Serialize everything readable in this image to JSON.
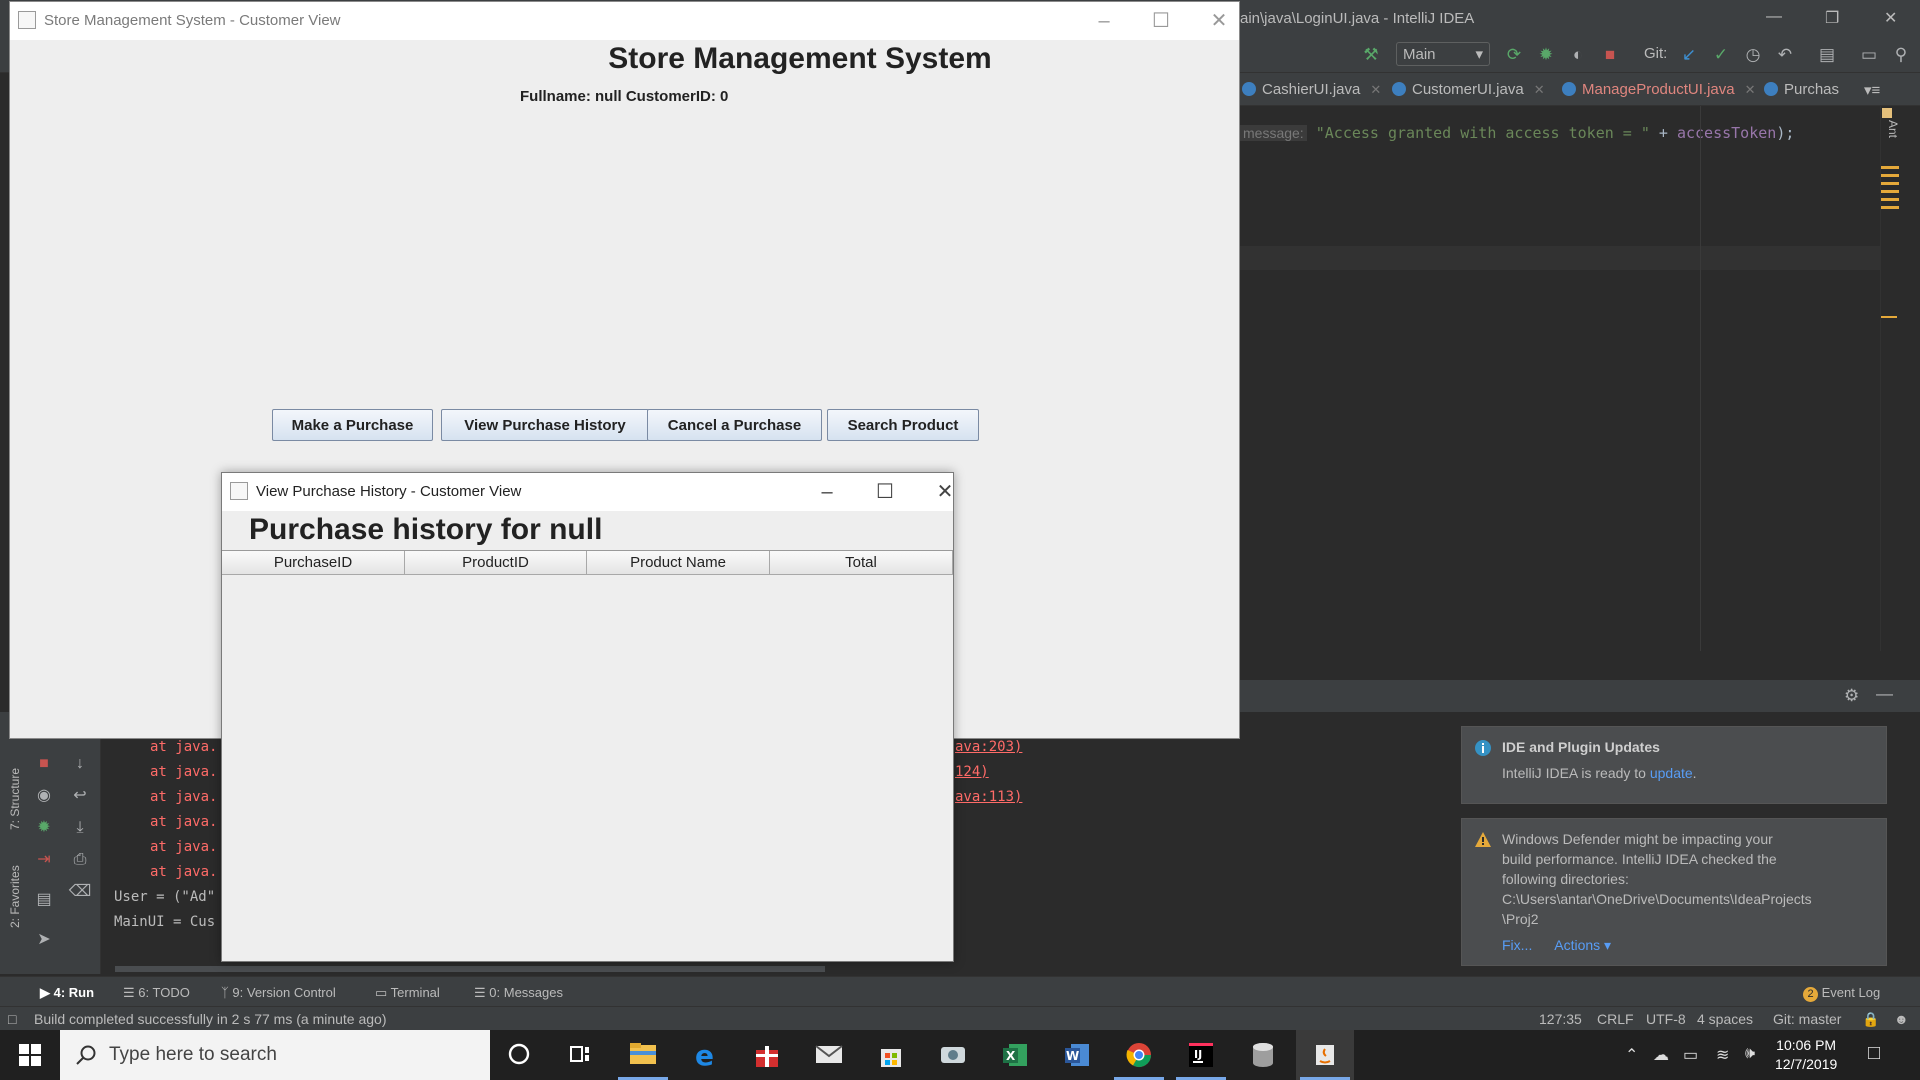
{
  "ide": {
    "title": "ain\\java\\LoginUI.java - IntelliJ IDEA",
    "branch": "Main",
    "git_label": "Git:",
    "tabs": [
      {
        "label": "CashierUI.java",
        "color": "#bbbbbb"
      },
      {
        "label": "CustomerUI.java",
        "color": "#bbbbbb"
      },
      {
        "label": "ManageProductUI.java",
        "color": "#e0867f"
      },
      {
        "label": "Purchas",
        "color": "#bbbbbb"
      }
    ],
    "code": {
      "hint": "message:",
      "string": "\"Access granted with access token = \"",
      "op": " + ",
      "var": "accessToken",
      "end": ");"
    },
    "console": {
      "left_lines": [
        "at java.",
        "at java.",
        "at java.",
        "at java.",
        "at java.",
        "at java."
      ],
      "plain_lines": [
        "User = (\"Ad\"",
        "MainUI = Cus"
      ],
      "right_lines": [
        "ava:203)",
        "124)",
        "ava:113)"
      ]
    },
    "side_labels": {
      "structure": "7: Structure",
      "favorites": "2: Favorites",
      "ant": "Ant"
    },
    "bottom_tabs": [
      "4: Run",
      "6: TODO",
      "9: Version Control",
      "Terminal",
      "0: Messages"
    ],
    "event_log": "Event Log",
    "event_log_count": "2",
    "status": {
      "message": "Build completed successfully in 2 s 77 ms (a minute ago)",
      "position": "127:35",
      "line_sep": "CRLF",
      "encoding": "UTF-8",
      "indent": "4 spaces",
      "git": "Git: master"
    },
    "notifications": [
      {
        "title": "IDE and Plugin Updates",
        "text": "IntelliJ IDEA is ready to ",
        "link": "update",
        "tail": "."
      },
      {
        "lines": [
          "Windows Defender might be impacting your",
          "build performance. IntelliJ IDEA checked the",
          "following directories:",
          "C:\\Users\\antar\\OneDrive\\Documents\\IdeaProjects",
          "\\Proj2"
        ],
        "fix": "Fix...",
        "actions": "Actions ▾"
      }
    ]
  },
  "main_window": {
    "title": "Store Management System - Customer View",
    "heading": "Store Management System",
    "subheading": "Fullname: null  CustomerID: 0",
    "buttons": [
      "Make a Purchase",
      "View Purchase History",
      "Cancel a Purchase",
      "Search Product"
    ]
  },
  "dialog": {
    "title": "View Purchase History - Customer View",
    "heading": "Purchase history for null",
    "columns": [
      "PurchaseID",
      "ProductID",
      "Product Name",
      "Total"
    ],
    "rows": []
  },
  "taskbar": {
    "search_placeholder": "Type here to search",
    "time": "10:06 PM",
    "date": "12/7/2019"
  },
  "colors": {
    "ide_bg": "#2b2b2b",
    "ide_panel": "#3c3f41",
    "swing_bg": "#eeeeee",
    "button_grad_top": "#f3f6fb",
    "button_grad_bottom": "#d6e2f0",
    "taskbar": "#202020",
    "accent_blue": "#589df6"
  }
}
